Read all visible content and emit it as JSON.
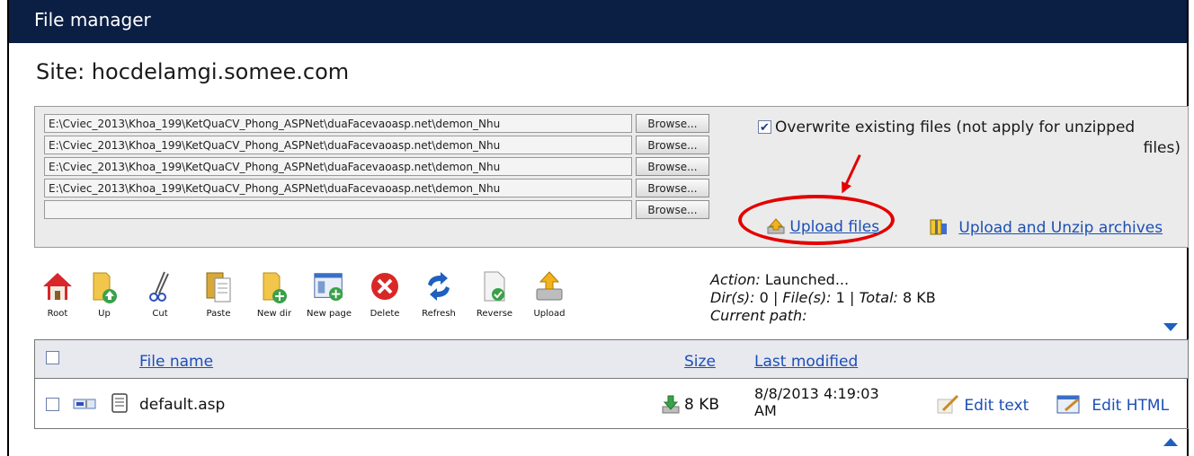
{
  "window": {
    "title": "File manager"
  },
  "site": {
    "label": "Site: hocdelamgi.somee.com"
  },
  "upload": {
    "files": [
      "E:\\Cviec_2013\\Khoa_199\\KetQuaCV_Phong_ASPNet\\duaFacevaoasp.net\\demon_Nhu",
      "E:\\Cviec_2013\\Khoa_199\\KetQuaCV_Phong_ASPNet\\duaFacevaoasp.net\\demon_Nhu",
      "E:\\Cviec_2013\\Khoa_199\\KetQuaCV_Phong_ASPNet\\duaFacevaoasp.net\\demon_Nhu",
      "E:\\Cviec_2013\\Khoa_199\\KetQuaCV_Phong_ASPNet\\duaFacevaoasp.net\\demon_Nhu",
      ""
    ],
    "browse_label": "Browse...",
    "overwrite_line1": "Overwrite existing files (not apply for unzipped",
    "overwrite_line2": "files)",
    "overwrite_checked": true,
    "upload_files_label": "Upload files",
    "upload_unzip_label": "Upload and Unzip archives",
    "highlight_color": "#e30000"
  },
  "toolbar": {
    "items": [
      {
        "label": "Root",
        "icon": "house-icon"
      },
      {
        "label": "Up",
        "icon": "folder-up-icon"
      },
      {
        "label": "Cut",
        "icon": "scissors-icon"
      },
      {
        "label": "Paste",
        "icon": "clipboard-icon"
      },
      {
        "label": "New dir",
        "icon": "new-folder-icon"
      },
      {
        "label": "New page",
        "icon": "new-page-icon"
      },
      {
        "label": "Delete",
        "icon": "delete-icon"
      },
      {
        "label": "Refresh",
        "icon": "refresh-icon"
      },
      {
        "label": "Reverse",
        "icon": "reverse-icon"
      },
      {
        "label": "Upload",
        "icon": "upload-icon"
      }
    ]
  },
  "status": {
    "action_label": "Action:",
    "action_value": "Launched...",
    "dirs_label": "Dir(s):",
    "dirs_value": "0",
    "files_label": "File(s):",
    "files_value": "1",
    "total_label": "Total:",
    "total_value": "8 KB",
    "separator": "|",
    "path_label": "Current path:"
  },
  "table": {
    "headers": {
      "name": "File name",
      "size": "Size",
      "modified": "Last modified"
    },
    "rows": [
      {
        "name": "default.asp",
        "size": "8 KB",
        "modified_line1": "8/8/2013 4:19:03",
        "modified_line2": "AM",
        "edit_text": "Edit text",
        "edit_html": "Edit HTML"
      }
    ]
  },
  "colors": {
    "titlebar": "#0b1e44",
    "link": "#1b4fb5"
  }
}
